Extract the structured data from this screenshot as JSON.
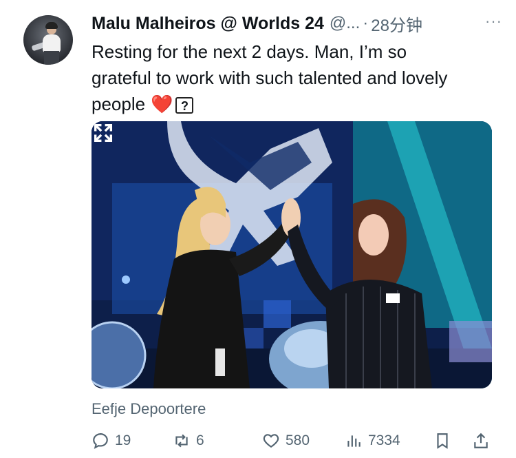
{
  "tweet": {
    "author_name": "Malu Malheiros @ Worlds 24",
    "handle": "@...",
    "separator": "·",
    "time": "28分钟",
    "more_label": "···",
    "text_line1": "Resting for the next 2 days. Man, I’m so",
    "text_line2": "grateful to work with such talented and lovely",
    "text_line3": "people",
    "emoji_heart": "❤️",
    "emoji_unknown": "?",
    "photo_credit": "Eefje Depoortere"
  },
  "actions": {
    "replies": "19",
    "reposts": "6",
    "likes": "580",
    "views": "7334"
  },
  "colors": {
    "text": "#0f1419",
    "secondary": "#536471",
    "heart": "#e0245e"
  },
  "icons": [
    "reply-icon",
    "repost-icon",
    "like-icon",
    "views-icon",
    "bookmark-icon",
    "share-icon",
    "expand-icon",
    "more-icon"
  ]
}
